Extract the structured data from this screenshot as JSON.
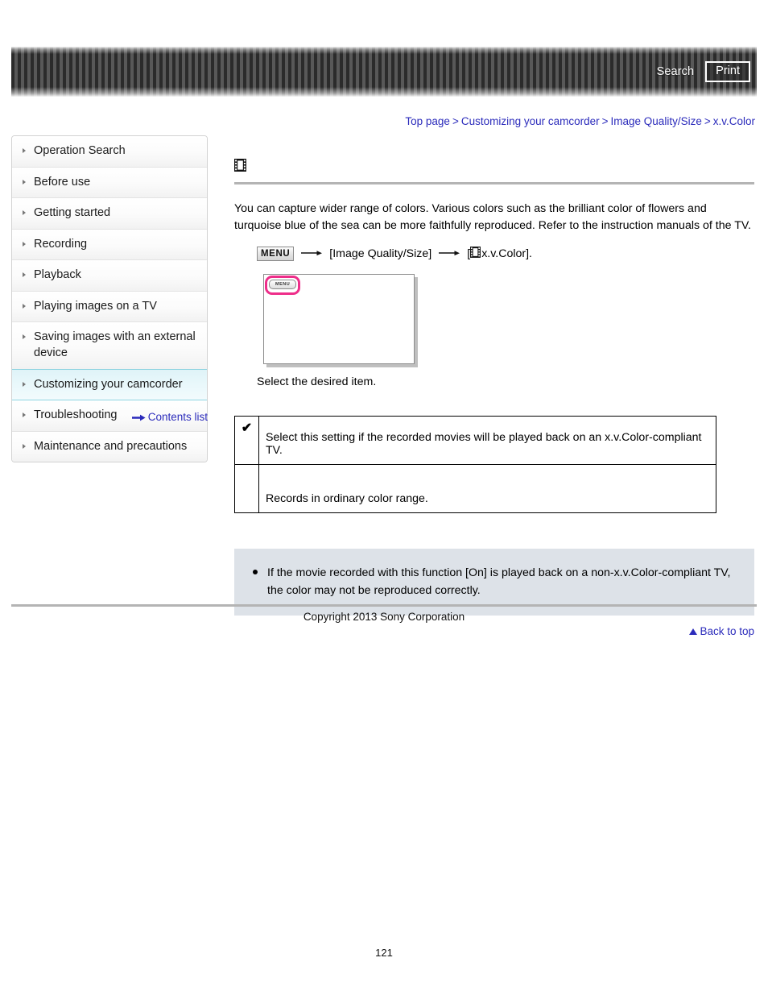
{
  "header": {
    "search_label": "Search",
    "print_label": "Print"
  },
  "breadcrumb": {
    "items": [
      {
        "label": "Top page"
      },
      {
        "label": "Customizing your camcorder"
      },
      {
        "label": "Image Quality/Size"
      },
      {
        "label": "x.v.Color"
      }
    ],
    "separator": ">"
  },
  "sidebar": {
    "items": [
      {
        "label": "Operation Search",
        "active": false
      },
      {
        "label": "Before use",
        "active": false
      },
      {
        "label": "Getting started",
        "active": false
      },
      {
        "label": "Recording",
        "active": false
      },
      {
        "label": "Playback",
        "active": false
      },
      {
        "label": "Playing images on a TV",
        "active": false
      },
      {
        "label": "Saving images with an external device",
        "active": false
      },
      {
        "label": "Customizing your camcorder",
        "active": true
      },
      {
        "label": "Troubleshooting",
        "active": false
      },
      {
        "label": "Maintenance and precautions",
        "active": false
      }
    ],
    "contents_list_label": "Contents list"
  },
  "main": {
    "title_icon": "film-strip-icon",
    "title": "",
    "description": "You can capture wider range of colors. Various colors such as the brilliant color of flowers and turquoise blue of the sea can be more faithfully reproduced. Refer to the instruction manuals of the TV.",
    "menu_path": {
      "menu_chip_label": "MENU",
      "step1": "[Image Quality/Size]",
      "step2_prefix": "[",
      "step2_icon": "film-strip-icon",
      "step2_label": "x.v.Color]."
    },
    "illustration": {
      "menu_button_label": "MENU",
      "highlight_color": "#ee2e8a"
    },
    "caption": "Select the desired item.",
    "options_table": {
      "rows": [
        {
          "mark": "✔",
          "description": "Select this setting if the recorded movies will be played back on an x.v.Color-compliant TV."
        },
        {
          "mark": "",
          "description": "Records in ordinary color range."
        }
      ]
    },
    "notes": [
      "If the movie recorded with this function [On] is played back on a non-x.v.Color-compliant TV, the color may not be reproduced correctly."
    ],
    "back_to_top_label": "Back to top"
  },
  "footer": {
    "copyright": "Copyright 2013 Sony Corporation",
    "page_number": "121"
  }
}
